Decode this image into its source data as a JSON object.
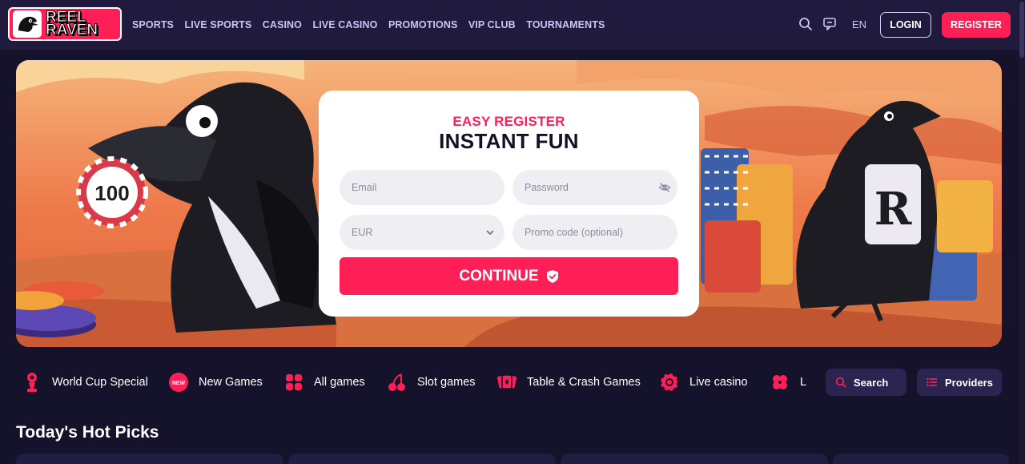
{
  "brand": {
    "name_line1": "REEL",
    "name_line2": "RAVEN",
    "accent": "#ff1f57",
    "background": "#15122b",
    "header_bg": "#201b3e"
  },
  "nav": {
    "items": [
      "SPORTS",
      "LIVE SPORTS",
      "CASINO",
      "LIVE CASINO",
      "PROMOTIONS",
      "VIP CLUB",
      "TOURNAMENTS"
    ]
  },
  "header": {
    "search_icon": "search-icon",
    "chat_icon": "chat-icon",
    "language": "EN",
    "login_label": "LOGIN",
    "register_label": "REGISTER"
  },
  "hero": {
    "left_chip_text": "100",
    "right_jacket_letter": "R"
  },
  "register_form": {
    "eyebrow": "EASY REGISTER",
    "title": "INSTANT FUN",
    "email_placeholder": "Email",
    "password_placeholder": "Password",
    "currency_value": "EUR",
    "promo_placeholder": "Promo code (optional)",
    "continue_label": "CONTINUE"
  },
  "categories": [
    {
      "label": "World Cup Special",
      "icon": "trophy-icon"
    },
    {
      "label": "New Games",
      "icon": "new-badge-icon"
    },
    {
      "label": "All games",
      "icon": "grid-icon"
    },
    {
      "label": "Slot games",
      "icon": "cherries-icon"
    },
    {
      "label": "Table & Crash Games",
      "icon": "cards-icon"
    },
    {
      "label": "Live casino",
      "icon": "chip-icon"
    },
    {
      "label": "L",
      "icon": "clover-icon"
    }
  ],
  "toolbar": {
    "search_label": "Search",
    "providers_label": "Providers"
  },
  "sections": {
    "hot_picks_title": "Today's Hot Picks"
  }
}
